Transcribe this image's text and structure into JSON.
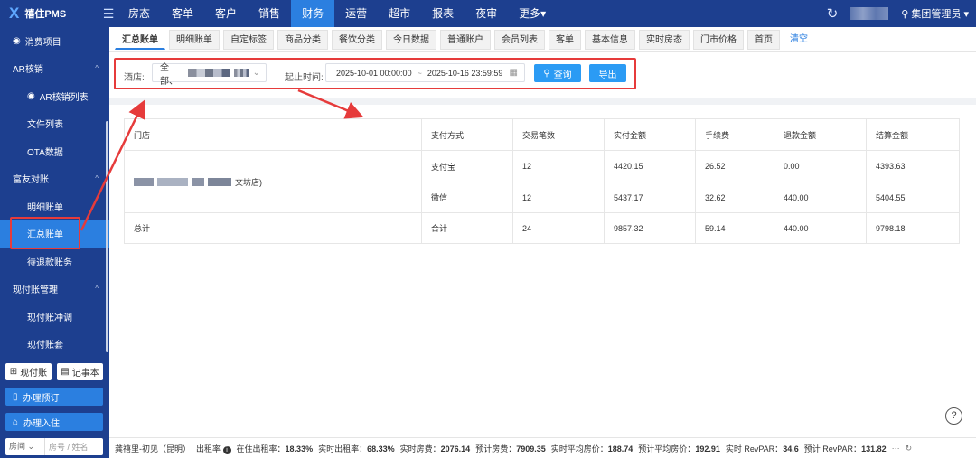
{
  "app": {
    "logo": "禧住PMS"
  },
  "nav": [
    "房态",
    "客单",
    "客户",
    "销售",
    "财务",
    "运营",
    "超市",
    "报表",
    "夜审",
    "更多▾"
  ],
  "nav_active": 4,
  "user": "集团管理员",
  "sidebar": {
    "items": [
      {
        "label": "消费项目",
        "type": "item",
        "icon": "◉"
      },
      {
        "label": "AR核销",
        "type": "group"
      },
      {
        "label": "AR核销列表",
        "type": "sub",
        "icon": "◉"
      },
      {
        "label": "文件列表",
        "type": "sub"
      },
      {
        "label": "OTA数据",
        "type": "sub"
      },
      {
        "label": "富友对账",
        "type": "group"
      },
      {
        "label": "明细账单",
        "type": "sub"
      },
      {
        "label": "汇总账单",
        "type": "sub",
        "active": true
      },
      {
        "label": "待退款账务",
        "type": "sub"
      },
      {
        "label": "现付账管理",
        "type": "group"
      },
      {
        "label": "现付账冲调",
        "type": "sub"
      },
      {
        "label": "现付账套",
        "type": "sub"
      }
    ],
    "btn_cash": "现付账",
    "btn_notebook": "记事本",
    "btn_booking": "办理预订",
    "btn_checkin": "办理入住",
    "room_select": "房间",
    "room_placeholder": "房号 / 姓名"
  },
  "tabs": [
    "汇总账单",
    "明细账单",
    "自定标签",
    "商品分类",
    "餐饮分类",
    "今日数据",
    "普通账户",
    "会员列表",
    "客单",
    "基本信息",
    "实时房态",
    "门市价格",
    "首页",
    "清空"
  ],
  "filter": {
    "hotel_label": "酒店:",
    "hotel_value": "全部、",
    "time_label": "起止时间:",
    "date_start": "2025-10-01 00:00:00",
    "date_sep": "~",
    "date_end": "2025-10-16 23:59:59",
    "query": "查询",
    "export": "导出"
  },
  "table": {
    "headers": [
      "门店",
      "支付方式",
      "交易笔数",
      "实付金额",
      "手续费",
      "退款金额",
      "结算金额"
    ],
    "store_suffix": "文坊店)",
    "rows": [
      {
        "pay": "支付宝",
        "count": "12",
        "paid": "4420.15",
        "fee": "26.52",
        "refund": "0.00",
        "settle": "4393.63"
      },
      {
        "pay": "微信",
        "count": "12",
        "paid": "5437.17",
        "fee": "32.62",
        "refund": "440.00",
        "settle": "5404.55"
      }
    ],
    "total": {
      "store": "总计",
      "pay": "合计",
      "count": "24",
      "paid": "9857.32",
      "fee": "59.14",
      "refund": "440.00",
      "settle": "9798.18"
    }
  },
  "status": {
    "hotel": "龚禧里-初见（昆明）",
    "occ_label": "出租率",
    "s1": "在住出租率：",
    "v1": "18.33%",
    "s2": "实时出租率：",
    "v2": "68.33%",
    "s3": "实时房费：",
    "v3": "2076.14",
    "s4": "预计房费：",
    "v4": "7909.35",
    "s5": "实时平均房价：",
    "v5": "188.74",
    "s6": "预计平均房价：",
    "v6": "192.91",
    "s7": "实时 RevPAR：",
    "v7": "34.6",
    "s8": "预计 RevPAR：",
    "v8": "131.82"
  }
}
